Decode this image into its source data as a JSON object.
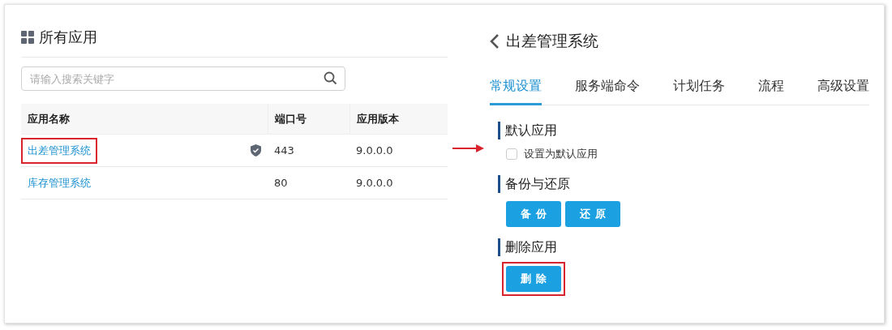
{
  "apps_panel": {
    "title": "所有应用",
    "search": {
      "placeholder": "请输入搜索关键字"
    },
    "table": {
      "columns": [
        "应用名称",
        "端口号",
        "应用版本"
      ],
      "rows": [
        {
          "name": "出差管理系统",
          "secured": true,
          "highlighted": true,
          "port": "443",
          "version": "9.0.0.0"
        },
        {
          "name": "库存管理系统",
          "secured": false,
          "highlighted": false,
          "port": "80",
          "version": "9.0.0.0"
        }
      ]
    }
  },
  "detail_panel": {
    "title": "出差管理系统",
    "tabs": [
      {
        "label": "常规设置",
        "selected": true
      },
      {
        "label": "服务端命令",
        "selected": false
      },
      {
        "label": "计划任务",
        "selected": false
      },
      {
        "label": "流程",
        "selected": false
      },
      {
        "label": "高级设置",
        "selected": false
      }
    ],
    "sections": [
      {
        "kind": "checkbox",
        "heading": "默认应用",
        "pointed": true,
        "options": [
          {
            "label": "设置为默认应用",
            "checked": false
          }
        ]
      },
      {
        "kind": "buttons",
        "heading": "备份与还原",
        "buttons": [
          {
            "label": "备份",
            "highlighted": false
          },
          {
            "label": "还原",
            "highlighted": false
          }
        ]
      },
      {
        "kind": "buttons",
        "heading": "删除应用",
        "buttons": [
          {
            "label": "删除",
            "highlighted": true
          }
        ]
      }
    ]
  }
}
